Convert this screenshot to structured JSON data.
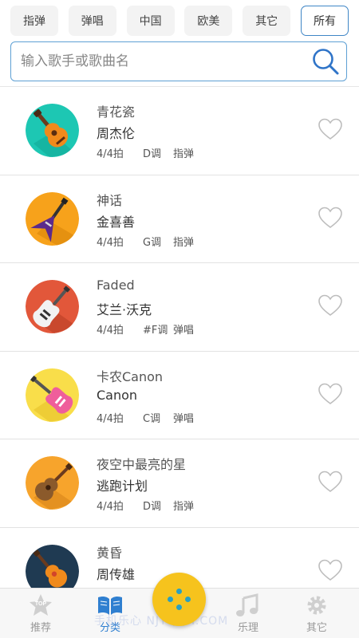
{
  "tabs": [
    {
      "label": "指弹",
      "active": false
    },
    {
      "label": "弹唱",
      "active": false
    },
    {
      "label": "中国",
      "active": false
    },
    {
      "label": "欧美",
      "active": false
    },
    {
      "label": "其它",
      "active": false
    },
    {
      "label": "所有",
      "active": true
    }
  ],
  "search": {
    "placeholder": "输入歌手或歌曲名",
    "value": ""
  },
  "songs": [
    {
      "title": "青花瓷",
      "artist": "周杰伦",
      "beat": "4/4拍",
      "key": "D调",
      "style": "指弹",
      "icon": "acoustic-guitar-icon",
      "color": "#1dc7b3"
    },
    {
      "title": "神话",
      "artist": "金喜善",
      "beat": "4/4拍",
      "key": "G调",
      "style": "指弹",
      "icon": "flying-v-guitar-icon",
      "color": "#f7a21b"
    },
    {
      "title": "Faded",
      "artist": "艾兰·沃克",
      "beat": "4/4拍",
      "key": "#F调",
      "style": "弹唱",
      "icon": "electric-guitar-icon",
      "color": "#e2573a"
    },
    {
      "title": "卡农Canon",
      "artist": "Canon",
      "beat": "4/4拍",
      "key": "C调",
      "style": "弹唱",
      "icon": "pink-electric-guitar-icon",
      "color": "#f9de4a"
    },
    {
      "title": "夜空中最亮的星",
      "artist": "逃跑计划",
      "beat": "4/4拍",
      "key": "D调",
      "style": "指弹",
      "icon": "classical-guitar-icon",
      "color": "#f7a42c"
    },
    {
      "title": "黄昏",
      "artist": "周传雄",
      "beat": "",
      "key": "",
      "style": "",
      "icon": "ukulele-icon",
      "color": "#1f3a52"
    }
  ],
  "nav": [
    {
      "label": "推荐",
      "icon": "top-star-icon",
      "active": false
    },
    {
      "label": "分类",
      "icon": "book-icon",
      "active": true
    },
    {
      "label": "乐理",
      "icon": "music-note-icon",
      "active": false
    },
    {
      "label": "其它",
      "icon": "gear-icon",
      "active": false
    }
  ],
  "fab": {
    "icon": "dots-icon"
  },
  "watermark": "手机乐心 NJYQQH.COM",
  "colors": {
    "accent": "#2f7fd0",
    "fab": "#f6c31d",
    "divider": "#e2e2e2"
  }
}
